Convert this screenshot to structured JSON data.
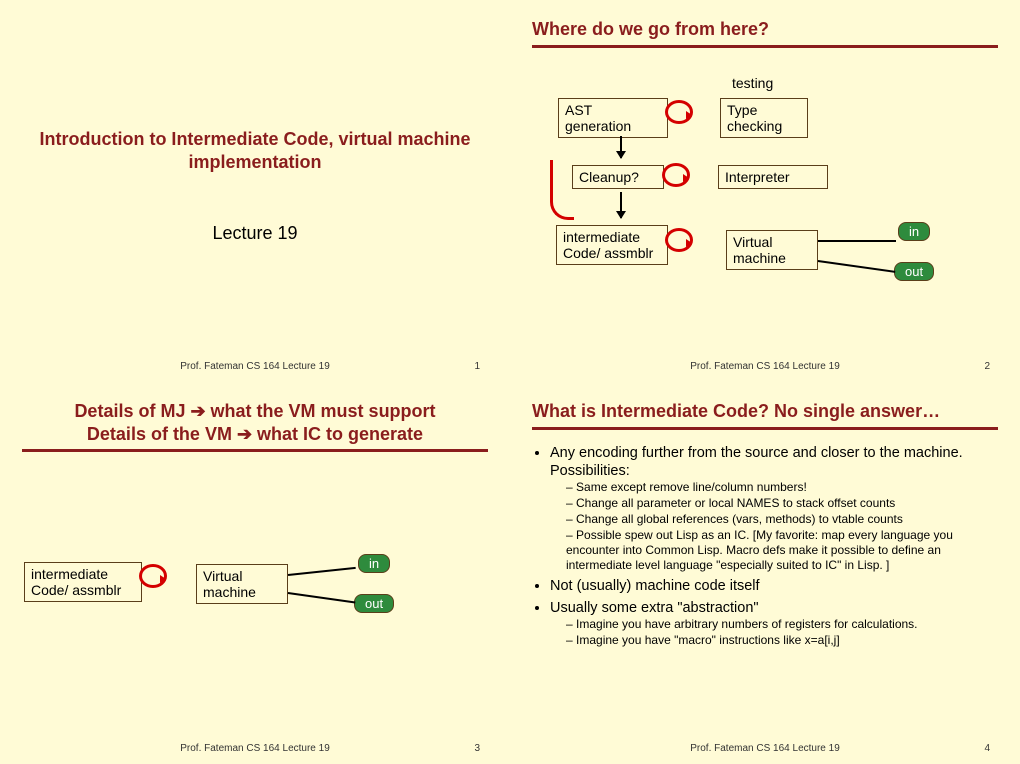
{
  "footer": {
    "author": "Prof. Fateman  CS 164  Lecture 19"
  },
  "slide1": {
    "title": "Introduction to Intermediate Code, virtual machine implementation",
    "subtitle": "Lecture 19",
    "page": "1"
  },
  "slide2": {
    "title": "Where do we go from here?",
    "testing": "testing",
    "boxes": {
      "ast": "AST generation",
      "type": "Type checking",
      "cleanup": "Cleanup?",
      "interp": "Interpreter",
      "ic": "intermediate Code/ assmblr",
      "vm": "Virtual machine"
    },
    "pill_in": "in",
    "pill_out": "out",
    "page": "2"
  },
  "slide3": {
    "title_l1": "Details of MJ ➔ what the VM must support",
    "title_l2": "Details of the VM ➔ what IC to generate",
    "boxes": {
      "ic": "intermediate Code/ assmblr",
      "vm": "Virtual machine"
    },
    "pill_in": "in",
    "pill_out": "out",
    "page": "3"
  },
  "slide4": {
    "title": "What is Intermediate Code? No single answer…",
    "b1": "Any encoding further from the source and closer to the machine.  Possibilities:",
    "s1a": "Same except remove line/column numbers!",
    "s1b": "Change all parameter or local NAMES to stack offset counts",
    "s1c": "Change all global references (vars, methods) to vtable counts",
    "s1d": "Possible spew out Lisp as an IC. [My favorite: map every language you encounter into Common Lisp. Macro defs make it possible to define an intermediate level language \"especially suited to IC\" in Lisp. ]",
    "b2": "Not (usually) machine code itself",
    "b3": "Usually some extra \"abstraction\"",
    "s3a": "Imagine you have arbitrary numbers of registers for calculations.",
    "s3b": "Imagine you have \"macro\" instructions like x=a[i,j]",
    "page": "4"
  }
}
